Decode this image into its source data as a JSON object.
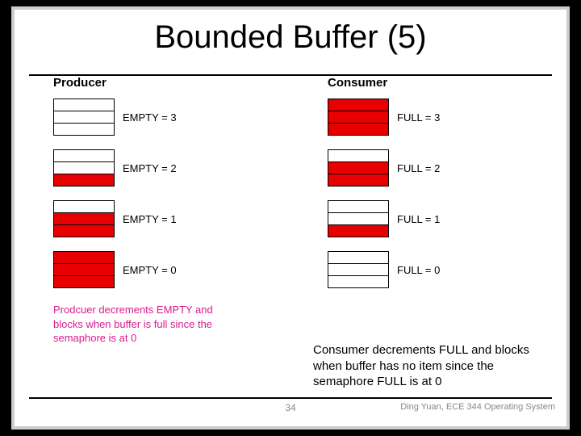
{
  "title": "Bounded Buffer (5)",
  "producer": {
    "heading": "Producer",
    "states": [
      {
        "filled": 0,
        "label": "EMPTY = 3"
      },
      {
        "filled": 1,
        "label": "EMPTY = 2"
      },
      {
        "filled": 2,
        "label": "EMPTY = 1"
      },
      {
        "filled": 3,
        "label": "EMPTY = 0"
      }
    ],
    "note": "Prodcuer decrements EMPTY and blocks when buffer is full since the semaphore is at 0"
  },
  "consumer": {
    "heading": "Consumer",
    "states": [
      {
        "filled": 3,
        "label": "FULL = 3"
      },
      {
        "filled": 2,
        "label": "FULL = 2"
      },
      {
        "filled": 1,
        "label": "FULL = 1"
      },
      {
        "filled": 0,
        "label": "FULL = 0"
      }
    ],
    "note": "Consumer decrements FULL and blocks when buffer has no item since the semaphore FULL is at 0"
  },
  "page": "34",
  "footer": "Ding Yuan, ECE 344 Operating System"
}
